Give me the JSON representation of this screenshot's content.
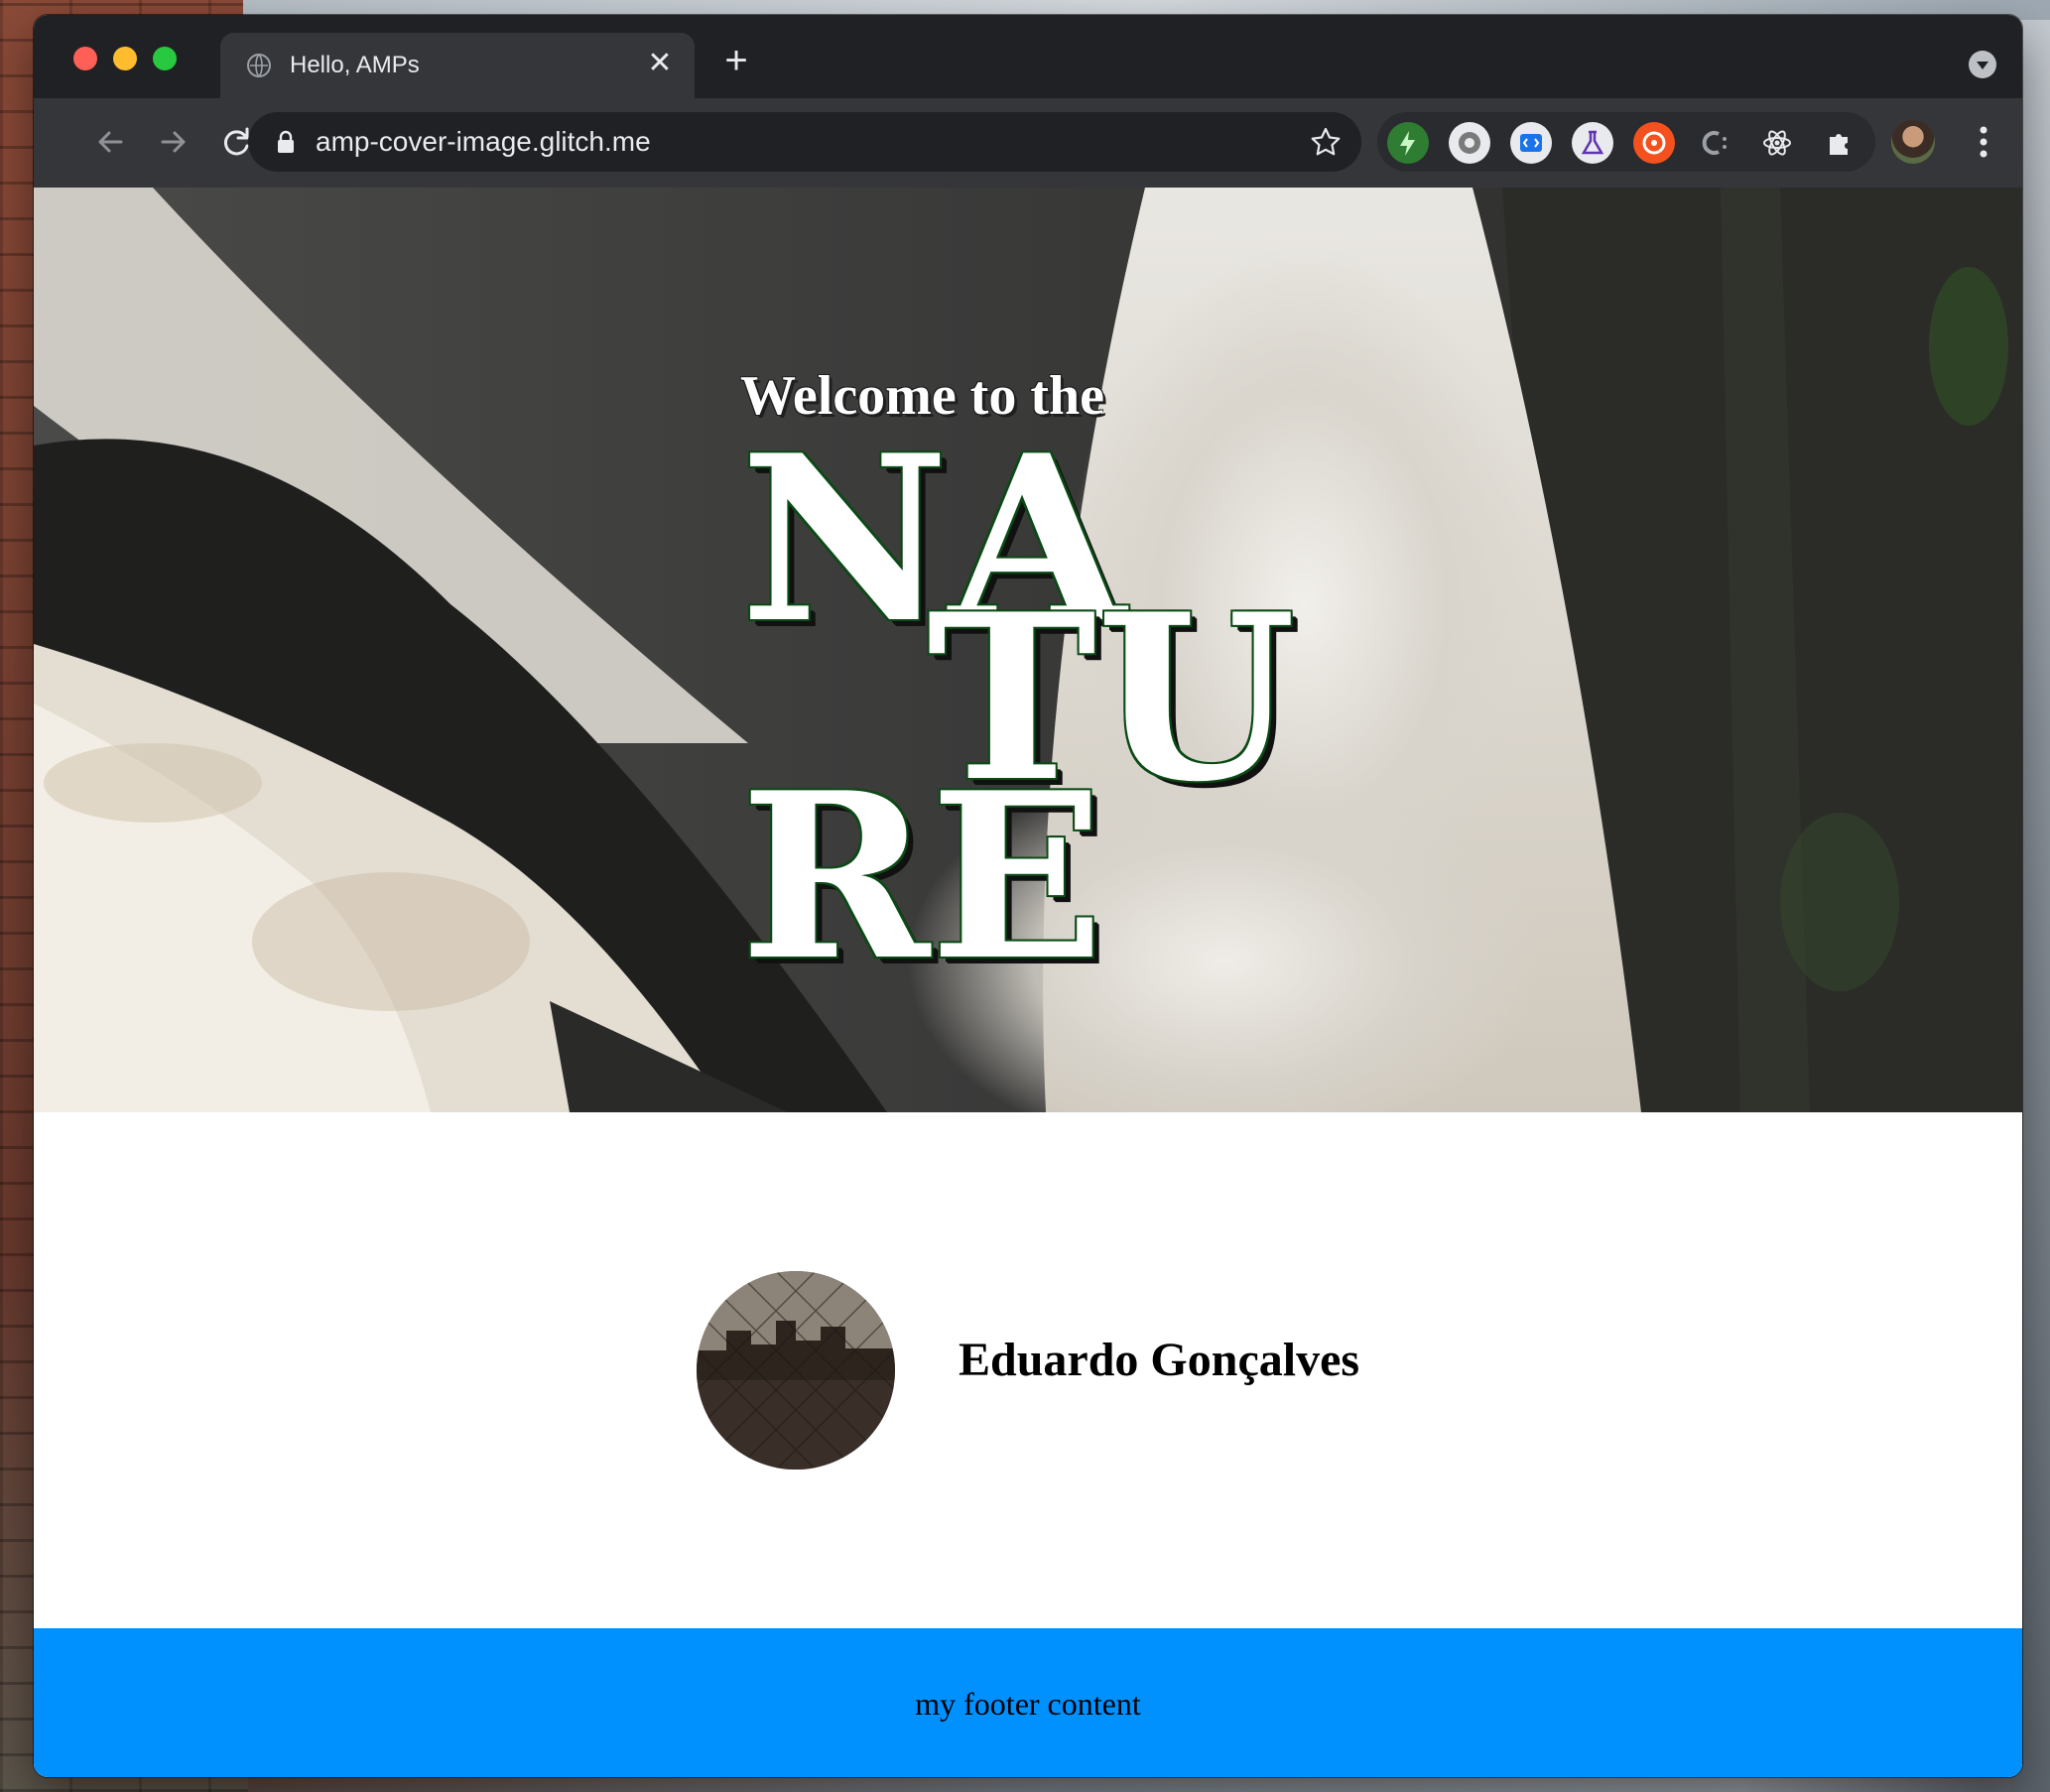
{
  "browser": {
    "tab": {
      "title": "Hello, AMPs",
      "close_glyph": "✕"
    },
    "new_tab_glyph": "+",
    "address": {
      "url": "amp-cover-image.glitch.me"
    }
  },
  "page": {
    "hero": {
      "welcome": "Welcome to the",
      "title_parts": [
        "NA",
        "TU",
        "RE"
      ]
    },
    "author": {
      "name": "Eduardo Gonçalves"
    },
    "footer": {
      "text": "my footer content"
    }
  },
  "colors": {
    "footer_bg": "#0091ff",
    "title_outline": "#0a4a14"
  }
}
